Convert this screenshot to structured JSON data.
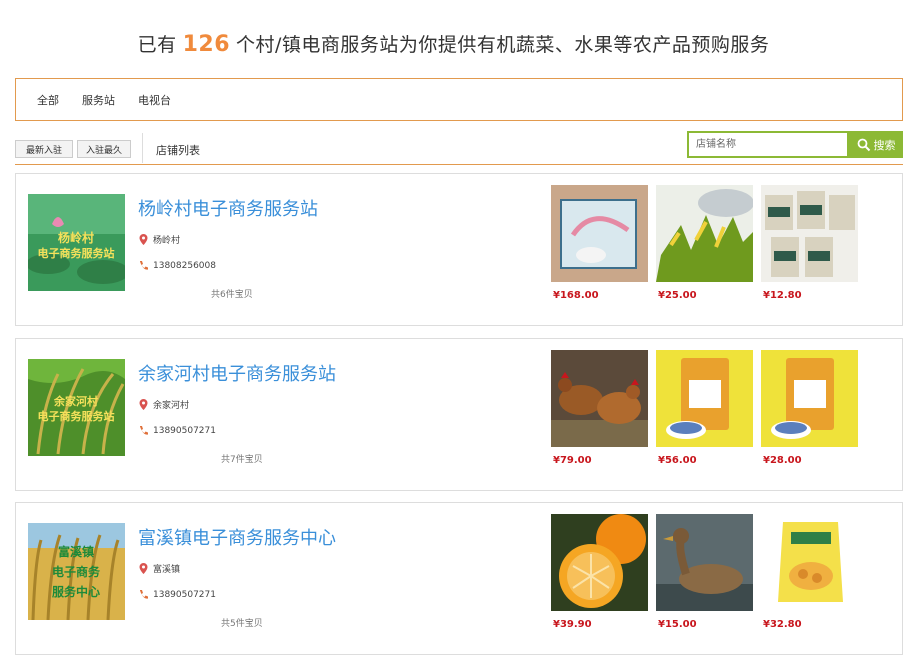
{
  "headline": {
    "prefix": "已有",
    "count": "126",
    "suffix": "个村/镇电商服务站为你提供有机蔬菜、水果等农产品预购服务"
  },
  "filters": [
    "全部",
    "服务站",
    "电视台"
  ],
  "toolbar": {
    "sort_newest": "最新入驻",
    "sort_oldest": "入驻最久",
    "list_label": "店铺列表",
    "search_placeholder": "店铺名称",
    "search_button": "搜索"
  },
  "stores": [
    {
      "thumb_text": [
        "杨岭村",
        "电子商务服务站"
      ],
      "name": "杨岭村电子商务服务站",
      "location": "杨岭村",
      "phone": "13808256008",
      "total": "共6件宝贝",
      "products": [
        {
          "price": "¥168.00"
        },
        {
          "price": "¥25.00"
        },
        {
          "price": "¥12.80"
        }
      ]
    },
    {
      "thumb_text": [
        "余家河村",
        "电子商务服务站"
      ],
      "name": "余家河村电子商务服务站",
      "location": "余家河村",
      "phone": "13890507271",
      "total": "共7件宝贝",
      "products": [
        {
          "price": "¥79.00"
        },
        {
          "price": "¥56.00"
        },
        {
          "price": "¥28.00"
        }
      ]
    },
    {
      "thumb_text": [
        "富溪镇",
        "电子商务",
        "服务中心"
      ],
      "name": "富溪镇电子商务服务中心",
      "location": "富溪镇",
      "phone": "13890507271",
      "total": "共5件宝贝",
      "products": [
        {
          "price": "¥39.90"
        },
        {
          "price": "¥15.00"
        },
        {
          "price": "¥32.80"
        }
      ]
    }
  ]
}
